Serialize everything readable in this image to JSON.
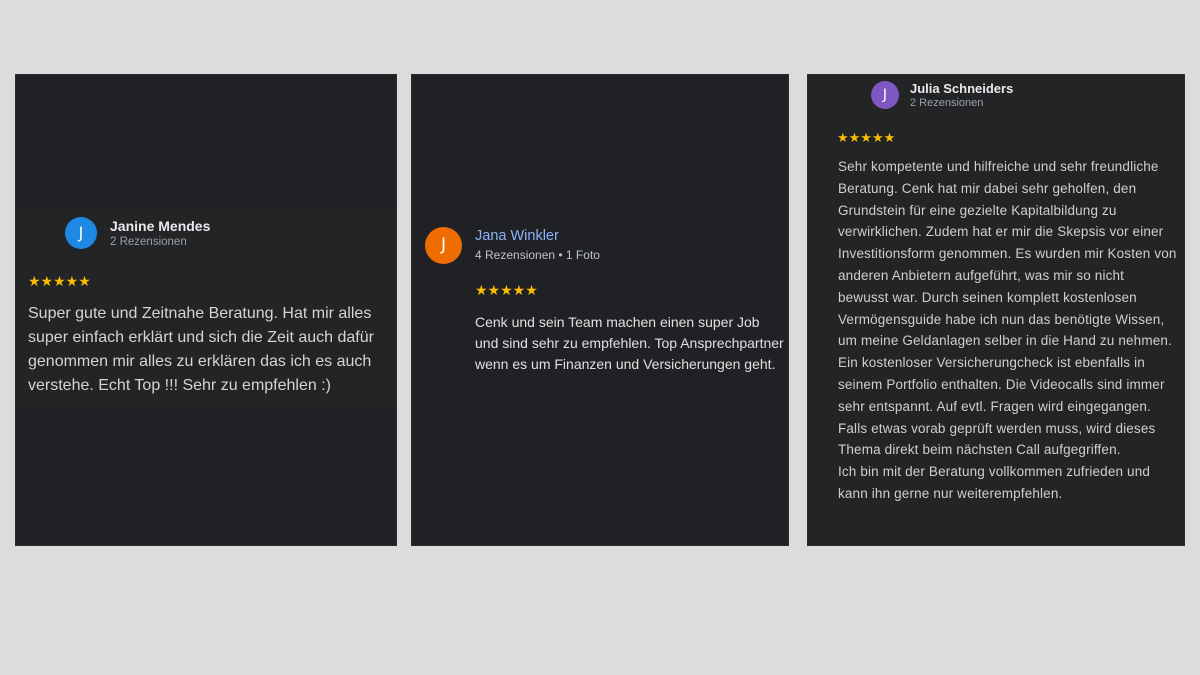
{
  "reviews": [
    {
      "avatar_letter": "J",
      "avatar_color": "#1e88e5",
      "name": "Janine Mendes",
      "meta": "2 Rezensionen",
      "stars": "★★★★★",
      "rating": 5,
      "text": "Super gute und Zeitnahe Beratung. Hat mir alles super einfach erklärt und sich die Zeit auch dafür genommen mir alles zu erklären das ich es auch verstehe. Echt Top !!! Sehr zu empfehlen :)"
    },
    {
      "avatar_letter": "J",
      "avatar_color": "#ef6c00",
      "name": "Jana Winkler",
      "meta": "4 Rezensionen • 1 Foto",
      "stars": "★★★★★",
      "rating": 5,
      "text": "Cenk und sein Team machen einen super Job und sind sehr zu empfehlen. Top Ansprechpartner wenn es um Finanzen und Versicherungen geht."
    },
    {
      "avatar_letter": "J",
      "avatar_color": "#7e57c2",
      "name": "Julia Schneiders",
      "meta": "2 Rezensionen",
      "stars": "★★★★★",
      "rating": 5,
      "text": "Sehr kompetente und hilfreiche und sehr freundliche Beratung. Cenk hat mir dabei sehr geholfen, den Grundstein für eine gezielte Kapitalbildung zu verwirklichen. Zudem hat er mir die Skepsis vor einer Investitionsform genommen. Es wurden mir Kosten von anderen Anbietern aufgeführt, was mir so nicht bewusst war. Durch seinen komplett kostenlosen Vermögensguide habe ich nun das benötigte Wissen, um meine Geldanlagen selber in die Hand zu nehmen. Ein kostenloser Versicherungcheck ist ebenfalls in seinem Portfolio enthalten. Die Videocalls sind immer sehr entspannt. Auf evtl. Fragen wird eingegangen. Falls etwas vorab geprüft werden muss, wird dieses Thema direkt beim nächsten Call aufgegriffen.\nIch bin mit der Beratung vollkommen zufrieden und kann ihn gerne nur weiterempfehlen."
    }
  ],
  "colors": {
    "page_background": "#dcdcdc",
    "card_background": "#202124",
    "star": "#fbbc04",
    "link_name": "#8ab4f8"
  }
}
